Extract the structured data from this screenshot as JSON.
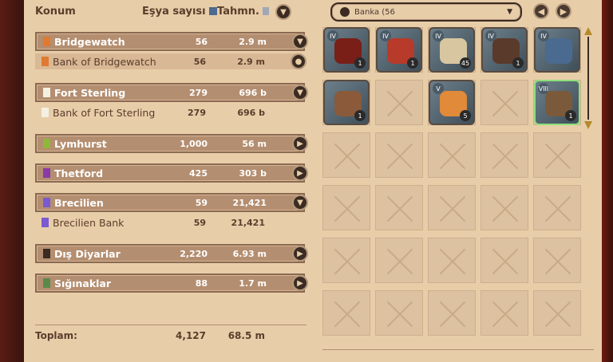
{
  "header": {
    "col_location": "Konum",
    "col_items": "Eşya sayısı",
    "col_estimate": "Tahmn."
  },
  "locations": [
    {
      "name": "Bridgewatch",
      "count": "56",
      "value": "2.9 m",
      "type": "region",
      "flag": "#e07a30",
      "btn": "down"
    },
    {
      "name": "Bank of Bridgewatch",
      "count": "56",
      "value": "2.9 m",
      "type": "sub",
      "flag": "#e07a30",
      "btn": "coin",
      "selected": true
    },
    {
      "name": "Fort Sterling",
      "count": "279",
      "value": "696 b",
      "type": "region",
      "flag": "#f3f0e2",
      "btn": "down"
    },
    {
      "name": "Bank of Fort Sterling",
      "count": "279",
      "value": "696 b",
      "type": "sub",
      "flag": "#f3f0e2",
      "btn": ""
    },
    {
      "name": "Lymhurst",
      "count": "1,000",
      "value": "56 m",
      "type": "region",
      "flag": "#8fb73a",
      "btn": "right"
    },
    {
      "name": "Thetford",
      "count": "425",
      "value": "303 b",
      "type": "region",
      "flag": "#8a3aa8",
      "btn": "right"
    },
    {
      "name": "Brecilien",
      "count": "59",
      "value": "21,421",
      "type": "region",
      "flag": "#7a5ad0",
      "btn": "down"
    },
    {
      "name": "Brecilien Bank",
      "count": "59",
      "value": "21,421",
      "type": "sub",
      "flag": "#7a5ad0",
      "btn": ""
    },
    {
      "name": "Dış Diyarlar",
      "count": "2,220",
      "value": "6.93 m",
      "type": "region",
      "flag": "#3b2b22",
      "btn": "right"
    },
    {
      "name": "Sığınaklar",
      "count": "88",
      "value": "1.7 m",
      "type": "region",
      "flag": "#5a8a4a",
      "btn": "right"
    }
  ],
  "total": {
    "label": "Toplam:",
    "count": "4,127",
    "value": "68.5 m"
  },
  "bank_dropdown": {
    "label": "Banka (56"
  },
  "items": [
    {
      "tier": "IV",
      "count": "1",
      "color": "#7a1e18"
    },
    {
      "tier": "IV",
      "count": "1",
      "color": "#b83a2a"
    },
    {
      "tier": "IV",
      "count": "45",
      "color": "#d8c6a0"
    },
    {
      "tier": "IV",
      "count": "1",
      "color": "#5a3a2a"
    },
    {
      "tier": "IV",
      "count": "",
      "color": "#4a6a90"
    },
    {
      "tier": "",
      "count": "1",
      "color": "#8a5a3a"
    },
    {
      "tier": "V",
      "count": "5",
      "color": "#e08a3a"
    },
    {
      "tier": "VIII",
      "count": "1",
      "color": "#7a5a3a"
    }
  ]
}
